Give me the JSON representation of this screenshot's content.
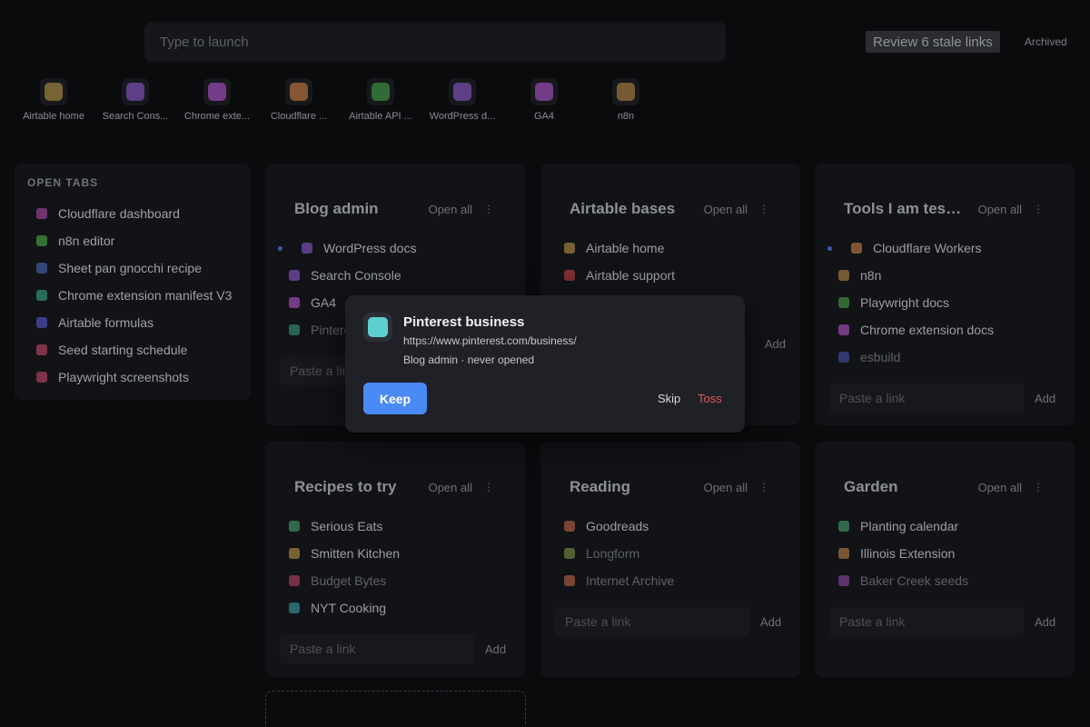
{
  "launcher": {
    "placeholder": "Type to launch"
  },
  "header": {
    "stale_label": "Review 6 stale links",
    "archived_label": "Archived"
  },
  "quick_launch": [
    {
      "label": "Airtable home",
      "color": "#c9a24a"
    },
    {
      "label": "Search Cons...",
      "color": "#9b5fe0"
    },
    {
      "label": "Chrome exte...",
      "color": "#c35be0"
    },
    {
      "label": "Cloudflare ...",
      "color": "#e08a4a"
    },
    {
      "label": "Airtable API ...",
      "color": "#4ab04a"
    },
    {
      "label": "WordPress d...",
      "color": "#9b5fe0"
    },
    {
      "label": "GA4",
      "color": "#c35be0"
    },
    {
      "label": "n8n",
      "color": "#c9934a"
    }
  ],
  "open_tabs": {
    "title": "OPEN TABS",
    "items": [
      {
        "label": "Cloudflare dashboard",
        "color": "#b04aa8"
      },
      {
        "label": "n8n editor",
        "color": "#4ab04a"
      },
      {
        "label": "Sheet pan gnocchi recipe",
        "color": "#4a6ab8"
      },
      {
        "label": "Chrome extension manifest V3",
        "color": "#3aa88a"
      },
      {
        "label": "Airtable formulas",
        "color": "#5a5ad0"
      },
      {
        "label": "Seed starting schedule",
        "color": "#c84a6a"
      },
      {
        "label": "Playwright screenshots",
        "color": "#c84a6a"
      }
    ]
  },
  "cards": {
    "blog": {
      "title": "Blog admin",
      "open_all": "Open all",
      "add": "Add",
      "paste_placeholder": "Paste a link",
      "links": [
        {
          "label": "WordPress docs",
          "color": "#9b5fe0"
        },
        {
          "label": "Search Console",
          "color": "#9b5fe0"
        },
        {
          "label": "GA4",
          "color": "#c35be0"
        },
        {
          "label": "Pinterest business",
          "color": "#3aa88a"
        }
      ]
    },
    "airtable": {
      "title": "Airtable bases",
      "open_all": "Open all",
      "add": "Add",
      "links": [
        {
          "label": "Airtable home",
          "color": "#c9a24a"
        },
        {
          "label": "Airtable support",
          "color": "#d04a4a"
        }
      ]
    },
    "tools": {
      "title": "Tools I am testing",
      "open_all": "Open all",
      "add": "Add",
      "paste_placeholder": "Paste a link",
      "links": [
        {
          "label": "Cloudflare Workers",
          "color": "#e08a4a"
        },
        {
          "label": "n8n",
          "color": "#c9934a"
        },
        {
          "label": "Playwright docs",
          "color": "#4ab04a"
        },
        {
          "label": "Chrome extension docs",
          "color": "#c35be0"
        },
        {
          "label": "esbuild",
          "color": "#4a5ab8"
        }
      ]
    },
    "recipes": {
      "title": "Recipes to try",
      "open_all": "Open all",
      "add": "Add",
      "paste_placeholder": "Paste a link",
      "links": [
        {
          "label": "Serious Eats",
          "color": "#4ab07a"
        },
        {
          "label": "Smitten Kitchen",
          "color": "#c9a24a"
        },
        {
          "label": "Budget Bytes",
          "color": "#c84a6a"
        },
        {
          "label": "NYT Cooking",
          "color": "#3ab0b0"
        }
      ]
    },
    "reading": {
      "title": "Reading",
      "open_all": "Open all",
      "add": "Add",
      "paste_placeholder": "Paste a link",
      "links": [
        {
          "label": "Goodreads",
          "color": "#d0704a"
        },
        {
          "label": "Longform",
          "color": "#8aa04a"
        },
        {
          "label": "Internet Archive",
          "color": "#d0704a"
        }
      ]
    },
    "garden": {
      "title": "Garden",
      "open_all": "Open all",
      "add": "Add",
      "paste_placeholder": "Paste a link",
      "links": [
        {
          "label": "Planting calendar",
          "color": "#4ab07a"
        },
        {
          "label": "Illinois Extension",
          "color": "#d08a4a"
        },
        {
          "label": "Baker Creek seeds",
          "color": "#9b4ab0"
        }
      ]
    }
  },
  "modal": {
    "title": "Pinterest business",
    "url": "https://www.pinterest.com/business/",
    "meta": "Blog admin · never opened",
    "icon_color": "#5ecfcf",
    "keep_label": "Keep",
    "skip_label": "Skip",
    "toss_label": "Toss"
  }
}
